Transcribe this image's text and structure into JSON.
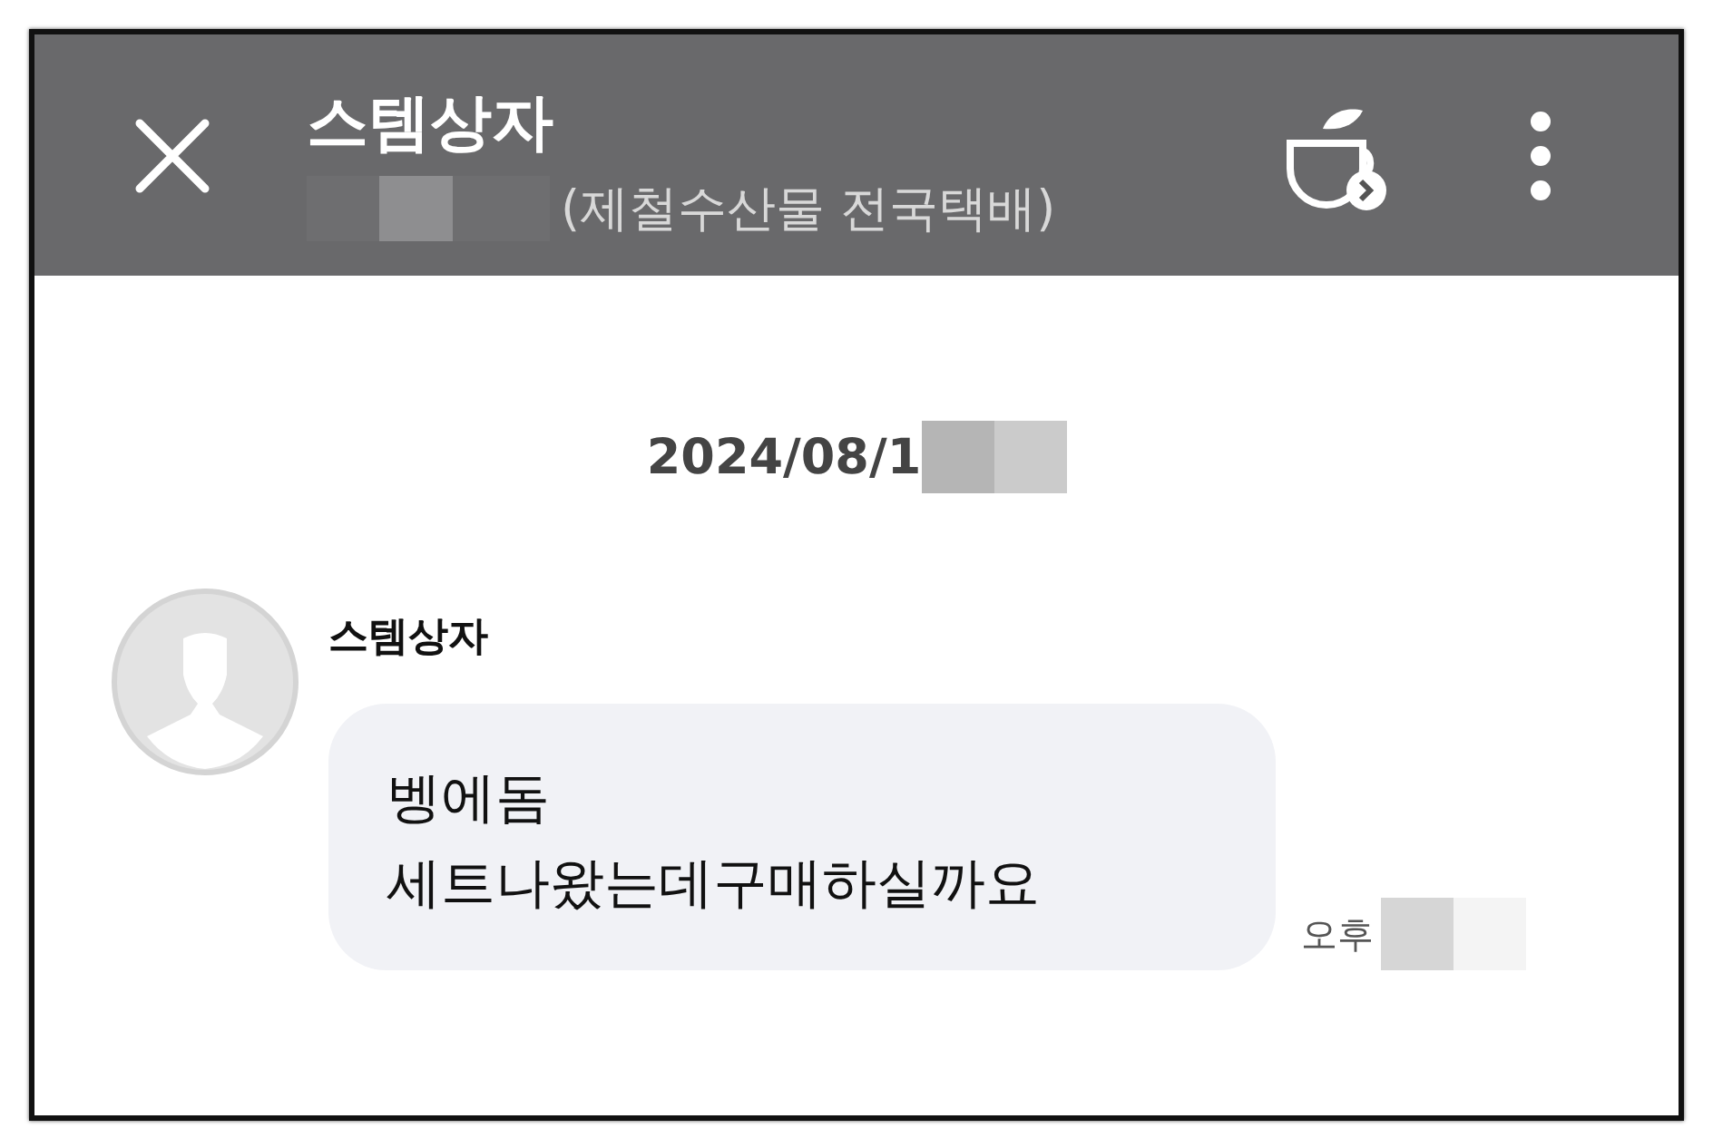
{
  "header": {
    "title": "스템상자",
    "subtitle": "(제철수산물 전국택배)"
  },
  "date_divider": "2024/08/1",
  "messages": [
    {
      "sender": "스템상자",
      "lines": [
        "벵에돔",
        "세트나왔는데구매하실까요"
      ],
      "time": "오후"
    }
  ]
}
